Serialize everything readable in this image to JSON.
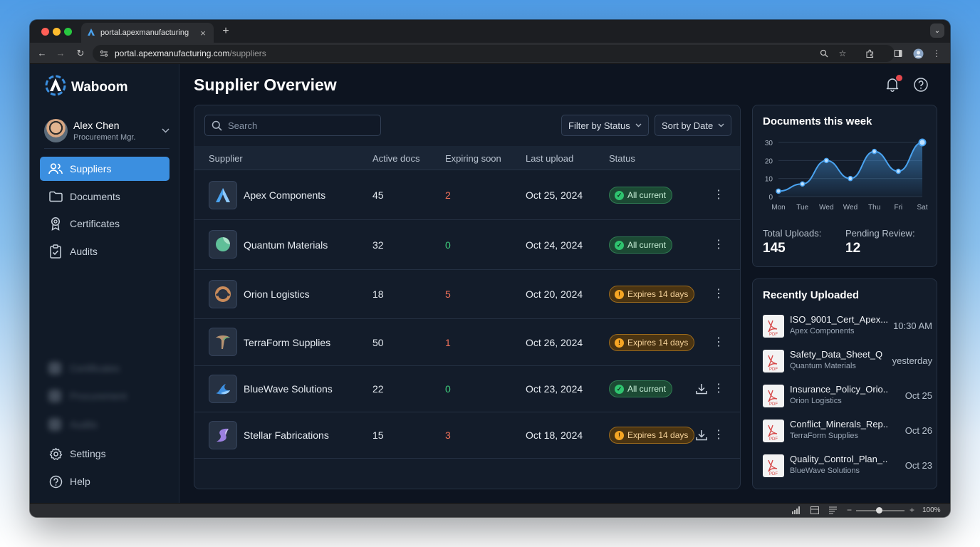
{
  "browser": {
    "tab_title": "portal.apexmanufacturing",
    "url_main": "portal.apexmanufacturing.com",
    "url_path": "/suppliers",
    "zoom": "100%"
  },
  "app": {
    "name": "Waboom",
    "user": {
      "name": "Alex Chen",
      "role": "Procurement Mgr."
    },
    "nav": [
      {
        "label": "Suppliers",
        "icon": "users-icon",
        "active": true
      },
      {
        "label": "Documents",
        "icon": "folder-icon",
        "active": false
      },
      {
        "label": "Certificates",
        "icon": "award-icon",
        "active": false
      },
      {
        "label": "Audits",
        "icon": "clipboard-check-icon",
        "active": false
      }
    ],
    "blurred_nav": [
      "Certificates",
      "Procurement",
      "Audits"
    ],
    "bottom_nav": [
      {
        "label": "Settings",
        "icon": "gear-icon"
      },
      {
        "label": "Help",
        "icon": "help-circle-icon"
      }
    ]
  },
  "page": {
    "title": "Supplier Overview"
  },
  "table": {
    "search_placeholder": "Search",
    "filter_label": "Filter by Status",
    "sort_label": "Sort by Date",
    "columns": [
      "Supplier",
      "Active docs",
      "Expiring soon",
      "Last upload",
      "Status"
    ],
    "rows": [
      {
        "name": "Apex Components",
        "active": "45",
        "expiring": "2",
        "expiring_color": "#f0715a",
        "last": "Oct 25, 2024",
        "status": "All current",
        "status_type": "ok",
        "download": false
      },
      {
        "name": "Quantum Materials",
        "active": "32",
        "expiring": "0",
        "expiring_color": "#3fcf7e",
        "last": "Oct 24, 2024",
        "status": "All current",
        "status_type": "ok",
        "download": false
      },
      {
        "name": "Orion Logistics",
        "active": "18",
        "expiring": "5",
        "expiring_color": "#f0715a",
        "last": "Oct 20, 2024",
        "status": "Expires 14 days",
        "status_type": "warn",
        "download": false
      },
      {
        "name": "TerraForm Supplies",
        "active": "50",
        "expiring": "1",
        "expiring_color": "#f0715a",
        "last": "Oct 26, 2024",
        "status": "Expires 14 days",
        "status_type": "warn",
        "download": false
      },
      {
        "name": "BlueWave Solutions",
        "active": "22",
        "expiring": "0",
        "expiring_color": "#3fcf7e",
        "last": "Oct 23, 2024",
        "status": "All current",
        "status_type": "ok",
        "download": true
      },
      {
        "name": "Stellar Fabrications",
        "active": "15",
        "expiring": "3",
        "expiring_color": "#f0715a",
        "last": "Oct 18, 2024",
        "status": "Expires 14 days",
        "status_type": "warn",
        "download": true
      }
    ]
  },
  "weekly": {
    "title": "Documents this week",
    "total_label": "Total Uploads:",
    "total_value": "145",
    "pending_label": "Pending Review:",
    "pending_value": "12"
  },
  "chart_data": {
    "type": "area",
    "categories": [
      "Mon",
      "Tue",
      "Wed",
      "Wed",
      "Thu",
      "Fri",
      "Sat"
    ],
    "values": [
      3,
      7,
      20,
      10,
      25,
      14,
      30
    ],
    "ylim": [
      0,
      30
    ],
    "yticks": [
      "0",
      "10",
      "20",
      "30"
    ],
    "grid": true,
    "color": "#4aa3f0"
  },
  "recent": {
    "title": "Recently Uploaded",
    "pdf_label": "PDF",
    "items": [
      {
        "name": "ISO_9001_Cert_Apex...",
        "supplier": "Apex Components",
        "time": "10:30 AM"
      },
      {
        "name": "Safety_Data_Sheet_Q",
        "supplier": "Quantum Materials",
        "time": "yesterday"
      },
      {
        "name": "Insurance_Policy_Orio...",
        "supplier": "Orion Logistics",
        "time": "Oct 25"
      },
      {
        "name": "Conflict_Minerals_Rep...",
        "supplier": "TerraForm Supplies",
        "time": "Oct 26"
      },
      {
        "name": "Quality_Control_Plan_...",
        "supplier": "BlueWave Solutions",
        "time": "Oct 23"
      }
    ]
  }
}
